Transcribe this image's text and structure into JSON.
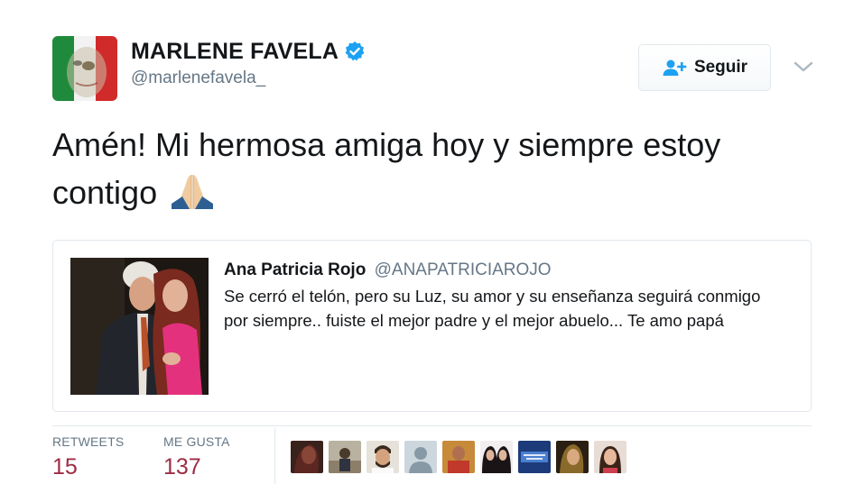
{
  "header": {
    "display_name": "MARLENE FAVELA",
    "handle": "@marlenefavela_",
    "follow_label": "Seguir"
  },
  "tweet": {
    "text": "Amén! Mi hermosa amiga hoy y siempre estoy contigo",
    "emoji_icon": "praying-hands-icon"
  },
  "quoted_tweet": {
    "name": "Ana Patricia Rojo",
    "handle": "@ANAPATRICIAROJO",
    "text": "Se cerró el telón, pero su Luz, su amor y su enseñanza seguirá conmigo por siempre.. fuiste el mejor padre y el mejor abuelo... Te amo papá"
  },
  "stats": {
    "retweets_label": "RETWEETS",
    "retweets_count": "15",
    "likes_label": "ME GUSTA",
    "likes_count": "137"
  },
  "likers_count_shown": 9,
  "colors": {
    "verified": "#1da1f2",
    "stat_value": "#9b2d44",
    "follow_icon": "#1da1f2",
    "muted": "#657786",
    "border": "#e1e8ed"
  }
}
